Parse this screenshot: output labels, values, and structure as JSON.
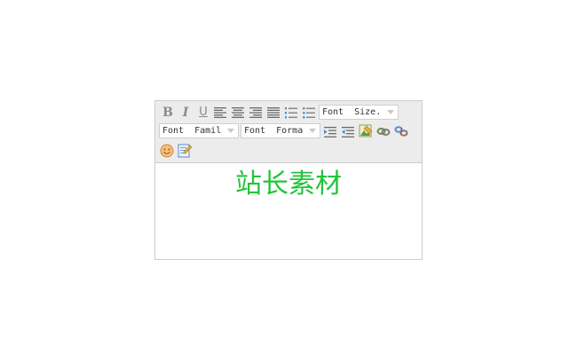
{
  "toolbar": {
    "buttons": [
      {
        "name": "bold",
        "glyph": "B"
      },
      {
        "name": "italic",
        "glyph": "I"
      },
      {
        "name": "underline",
        "glyph": "U"
      },
      {
        "name": "align-left"
      },
      {
        "name": "align-center"
      },
      {
        "name": "align-right"
      },
      {
        "name": "align-justify"
      },
      {
        "name": "ordered-list"
      },
      {
        "name": "unordered-list"
      },
      {
        "name": "outdent"
      },
      {
        "name": "indent"
      },
      {
        "name": "insert-image"
      },
      {
        "name": "insert-link"
      },
      {
        "name": "unlink"
      },
      {
        "name": "insert-smiley"
      },
      {
        "name": "html-source"
      }
    ],
    "font_size": {
      "label": "Font  Size."
    },
    "font_family": {
      "label": "Font  Famil"
    },
    "font_format": {
      "label": "Font  Forma"
    }
  },
  "content": {
    "text": "站长素材",
    "color": "#22c43a"
  },
  "colors": {
    "toolbar_bg": "#ececec",
    "border": "#cccccc",
    "icon_gray": "#8a8a8a",
    "list_blue": "#4a8fd8"
  }
}
